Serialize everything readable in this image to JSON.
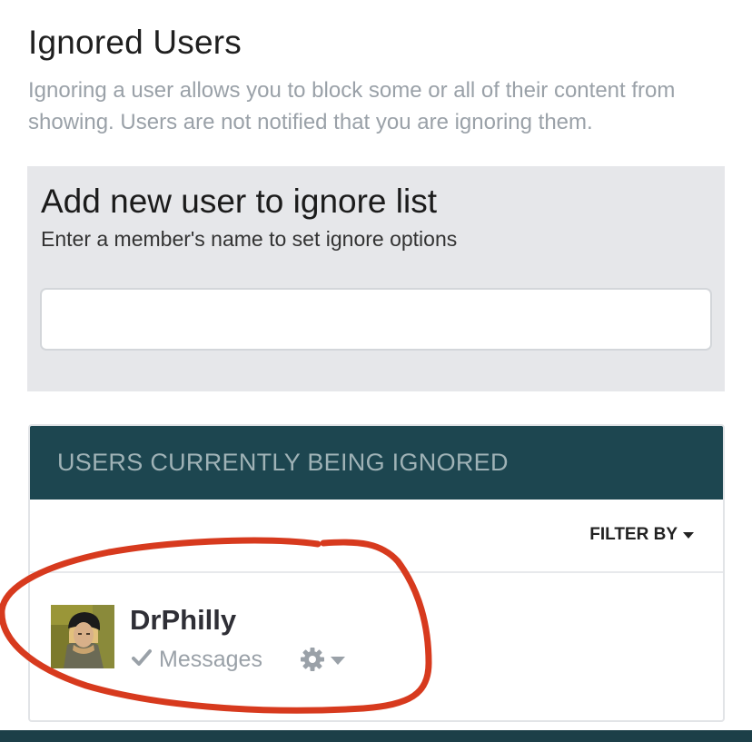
{
  "page": {
    "title": "Ignored Users",
    "description": "Ignoring a user allows you to block some or all of their content from showing. Users are not notified that you are ignoring them."
  },
  "add_user": {
    "title": "Add new user to ignore list",
    "subtitle": "Enter a member's name to set ignore options",
    "input_value": "",
    "input_placeholder": ""
  },
  "ignored_panel": {
    "header": "USERS CURRENTLY BEING IGNORED",
    "filter_label": "FILTER BY",
    "users": [
      {
        "name": "DrPhilly",
        "option_label": "Messages",
        "option_icon": "check-icon",
        "menu_icon": "gear-icon"
      }
    ]
  },
  "colors": {
    "panel_header_bg": "#1d4650",
    "annotation_circle": "#d73a1e",
    "muted_text": "#9aa1a8"
  }
}
